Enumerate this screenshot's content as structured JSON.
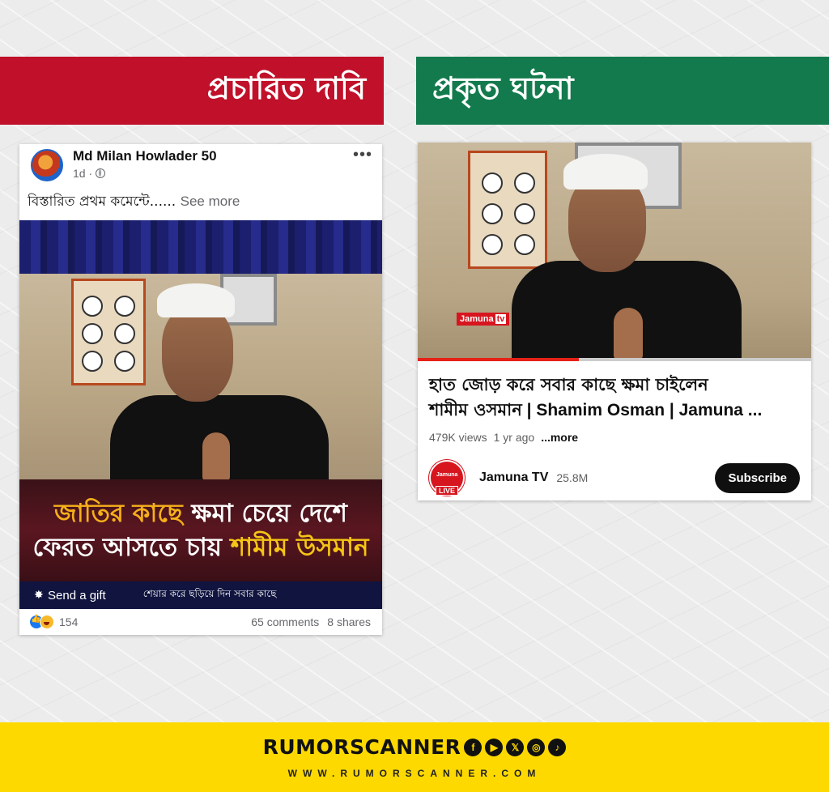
{
  "banners": {
    "left": "প্রচারিত দাবি",
    "right": "প্রকৃত ঘটনা"
  },
  "facebook_post": {
    "author": "Md Milan Howlader 50",
    "time": "1d ·",
    "caption": "বিস্তারিত প্রথম কমেন্টে......",
    "see_more": "See more",
    "image_title_line1_a": "জাতির কাছে ",
    "image_title_line1_b": "ক্ষমা চেয়ে দেশে",
    "image_title_line2_a": "ফেরত আসতে চায় ",
    "image_title_line2_b": "শামীম উসমান",
    "send_gift": "Send a gift",
    "share_note": "শেয়ার করে ছড়িয়ে দিন সবার কাছে",
    "reactions": "154",
    "comments": "65 comments",
    "shares": "8 shares",
    "more_icon": "more-dots-icon"
  },
  "youtube_video": {
    "logo_text": "Jamuna",
    "logo_tv": "tv",
    "title_bn": "হাত জোড় করে সবার কাছে ক্ষমা চাইলেন",
    "title_line2_bn": "শামীম ওসমান",
    "title_line2_en": " | Shamim Osman | Jamuna ...",
    "views": "479K views",
    "age": "1 yr ago",
    "more": "...more",
    "channel_name": "Jamuna TV",
    "subscribers": "25.8M",
    "subscribe_label": "Subscribe",
    "live_badge": "LIVE",
    "avatar_text": "Jamuna",
    "progress": 0.41
  },
  "footer": {
    "brand": "RUMORSCANNER",
    "url": "WWW.RUMORSCANNER.COM",
    "social_icons": [
      "facebook-icon",
      "youtube-icon",
      "x-icon",
      "instagram-icon",
      "tiktok-icon"
    ]
  },
  "colors": {
    "claim_red": "#c0102a",
    "fact_green": "#137a4d",
    "footer_yellow": "#fdd900"
  }
}
